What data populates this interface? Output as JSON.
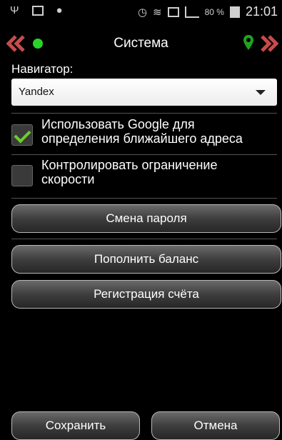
{
  "status_bar": {
    "battery_percent": "80 %",
    "time": "21:01",
    "icons": [
      "usb-icon",
      "image-icon",
      "alarm-icon",
      "wifi-icon",
      "sim-icon",
      "signal-icon",
      "battery-icon"
    ]
  },
  "header": {
    "title": "Система",
    "back_icon": "double-chevron-left-icon",
    "forward_icon": "double-chevron-right-icon",
    "status_dot_color": "#2ad32a",
    "pin_color": "#1fa31f"
  },
  "navigator": {
    "label": "Навигатор:",
    "selected": "Yandex"
  },
  "options": [
    {
      "text_line1": "Использовать Google для",
      "text_line2": "определения ближайшего адреса",
      "checked": true
    },
    {
      "text_line1": "Контролировать ограничение",
      "text_line2": "скорости",
      "checked": false
    }
  ],
  "buttons": {
    "change_password": "Смена пароля",
    "top_up_balance": "Пополнить баланс",
    "register_account": "Регистрация счёта",
    "save": "Сохранить",
    "cancel": "Отмена"
  },
  "colors": {
    "background": "#000000",
    "check_accent": "#6bcf2c",
    "chevron_accent": "#c94a4a"
  }
}
